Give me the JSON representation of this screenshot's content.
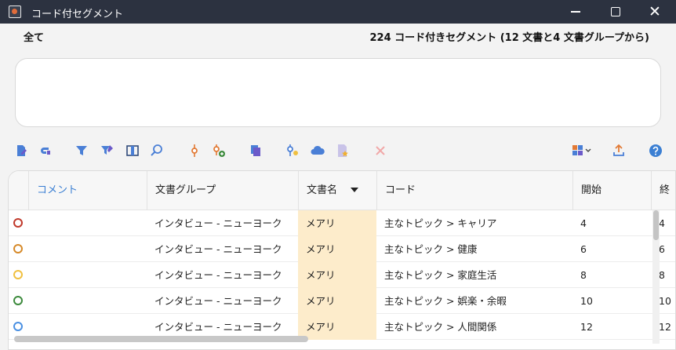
{
  "window": {
    "title": "コード付セグメント",
    "minimize_icon": "minimize-icon",
    "maximize_icon": "maximize-icon",
    "close_icon": "close-icon",
    "close_glyph": "✕"
  },
  "header": {
    "scope": "全て",
    "summary": "224 コード付きセグメント (12 文書と4 文書グループから)"
  },
  "memo": {
    "value": ""
  },
  "toolbar": {
    "left_icons": [
      "document-edit-icon",
      "link-icon",
      "filter-icon",
      "filter-settings-icon",
      "columns-icon",
      "search-icon",
      "code-pin-icon",
      "add-code-icon",
      "copy-icon",
      "code-settings-icon",
      "cloud-icon",
      "document-star-icon",
      "delete-icon"
    ],
    "right_icons": [
      "smart-coding-icon",
      "export-icon",
      "help-icon"
    ],
    "colors": {
      "blue": "#4a7fd6",
      "orange": "#e27a35",
      "purple": "#6b5ac9",
      "disabled": "#f1a8a8"
    }
  },
  "table": {
    "columns": [
      "コメント",
      "文書グループ",
      "文書名",
      "コード",
      "開始",
      "終"
    ],
    "rows": [
      {
        "color": "#c0392b",
        "comment": "",
        "group": "インタビュー - ニューヨーク",
        "doc": "メアリ",
        "code": "主なトピック > キャリア",
        "start": "4",
        "end": "4"
      },
      {
        "color": "#d68a2a",
        "comment": "",
        "group": "インタビュー - ニューヨーク",
        "doc": "メアリ",
        "code": "主なトピック > 健康",
        "start": "6",
        "end": "6"
      },
      {
        "color": "#f0c040",
        "comment": "",
        "group": "インタビュー - ニューヨーク",
        "doc": "メアリ",
        "code": "主なトピック > 家庭生活",
        "start": "8",
        "end": "8"
      },
      {
        "color": "#3c8a3c",
        "comment": "",
        "group": "インタビュー - ニューヨーク",
        "doc": "メアリ",
        "code": "主なトピック > 娯楽・余暇",
        "start": "10",
        "end": "10"
      },
      {
        "color": "#4a90e2",
        "comment": "",
        "group": "インタビュー - ニューヨーク",
        "doc": "メアリ",
        "code": "主なトピック > 人間関係",
        "start": "12",
        "end": "12"
      }
    ]
  }
}
